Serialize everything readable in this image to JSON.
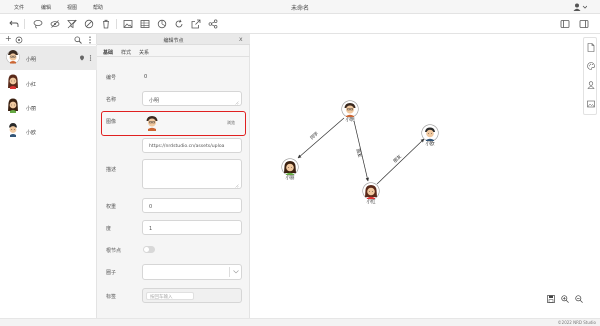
{
  "menu": {
    "file": "文件",
    "edit": "编辑",
    "view": "视图",
    "help": "帮助"
  },
  "window": {
    "title": "未命名"
  },
  "left": {
    "items": [
      {
        "name": "小明",
        "selected": true
      },
      {
        "name": "小红",
        "selected": false
      },
      {
        "name": "小丽",
        "selected": false
      },
      {
        "name": "小欧",
        "selected": false
      }
    ]
  },
  "panel": {
    "title": "编辑节点",
    "close": "x",
    "tabs": [
      "基础",
      "样式",
      "关系"
    ],
    "fields": {
      "id_label": "编号",
      "id_value": "0",
      "name_label": "名称",
      "name_value": "小明",
      "image_label": "图像",
      "image_button": "浏览",
      "image_url": "https://nrdstudio.cn/assets/uploa",
      "desc_label": "描述",
      "weight_label": "权重",
      "weight_value": "0",
      "degree_label": "度",
      "degree_value": "1",
      "root_label": "根节点",
      "group_label": "圈子",
      "tags_label": "标签",
      "tags_placeholder": "按回车输入"
    }
  },
  "graph": {
    "nodes": [
      "小明",
      "小丽",
      "小红",
      "小欧"
    ],
    "edges": [
      "同学",
      "朋友",
      "朋友"
    ]
  },
  "status": {
    "copyright": "©2022 NRD Studio"
  },
  "colors": {
    "highlight": "#e02020",
    "accent": "#d0d0d0"
  }
}
